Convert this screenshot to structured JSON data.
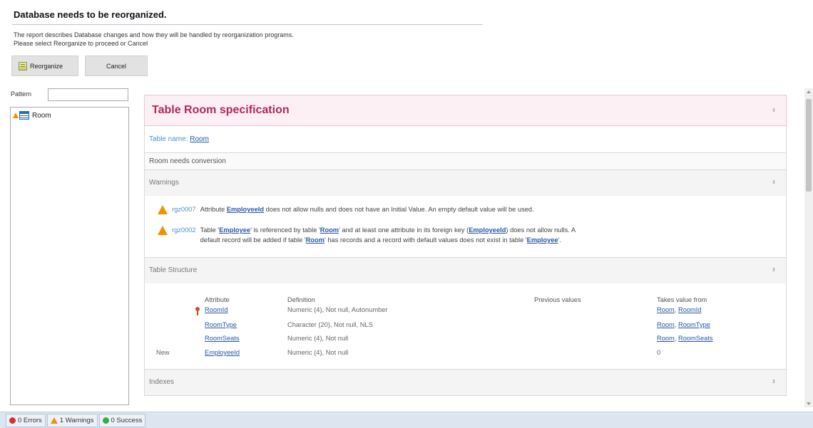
{
  "header": {
    "title": "Database needs to be reorganized.",
    "description_line1": "The report describes Database changes and how they will be handled by reorganization programs.",
    "description_line2": "Please select Reorganize to proceed or Cancel",
    "reorganize_label": "Reorganize",
    "cancel_label": "Cancel"
  },
  "left_panel": {
    "pattern_label": "Pattern",
    "pattern_value": "",
    "tree_items": [
      {
        "label": "Room",
        "icons": [
          "warning-icon",
          "table-icon"
        ]
      }
    ]
  },
  "spec": {
    "title": "Table Room specification",
    "table_name_label": "Table name: ",
    "table_name": "Room",
    "conversion_text": "Room needs conversion",
    "collapse_symbol": "⇕"
  },
  "warnings": {
    "title": "Warnings",
    "items": [
      {
        "code": "rgz0007",
        "pre": "Attribute ",
        "link": "EmployeeId",
        "post": " does not allow nulls and does not have an Initial Value. An empty default value will be used."
      },
      {
        "code": "rgz0002",
        "line1_pre": "Table '",
        "line1_link1": "Employee",
        "line1_mid1": "' is referenced by table '",
        "line1_link2": "Room",
        "line1_mid2": "' and at least one attribute in its foreign key (",
        "line1_link3": "EmployeeId",
        "line1_post": ") does not allow nulls. A",
        "line2_pre": "default record will be added if table '",
        "line2_link1": "Room",
        "line2_mid": "' has records and a record with default values does not exist in table '",
        "line2_link2": "Employee",
        "line2_post": "'."
      }
    ]
  },
  "structure": {
    "title": "Table Structure",
    "columns": [
      "Attribute",
      "Definition",
      "Previous values",
      "Takes value from"
    ],
    "rows": [
      {
        "marker": "",
        "key": true,
        "attribute": "RoomId",
        "definition": "Numeric (4), Not null, Autonumber",
        "previous": "",
        "takes_from_table": "Room",
        "takes_from_attr": "RoomId"
      },
      {
        "marker": "",
        "key": false,
        "attribute": "RoomType",
        "definition": "Character (20), Not null, NLS",
        "previous": "",
        "takes_from_table": "Room",
        "takes_from_attr": "RoomType"
      },
      {
        "marker": "",
        "key": false,
        "attribute": "RoomSeats",
        "definition": "Numeric (4), Not null",
        "previous": "",
        "takes_from_table": "Room",
        "takes_from_attr": "RoomSeats"
      },
      {
        "marker": "New",
        "key": false,
        "attribute": "EmployeeId",
        "definition": "Numeric (4), Not null",
        "previous": "",
        "takes_from_value": "0"
      }
    ]
  },
  "indexes": {
    "title": "Indexes"
  },
  "status": {
    "errors": "0 Errors",
    "warnings": "1 Warnings",
    "success": "0 Success"
  },
  "colors": {
    "accent": "#b2285e",
    "link": "#2a56a8",
    "warning": "#f29100"
  }
}
